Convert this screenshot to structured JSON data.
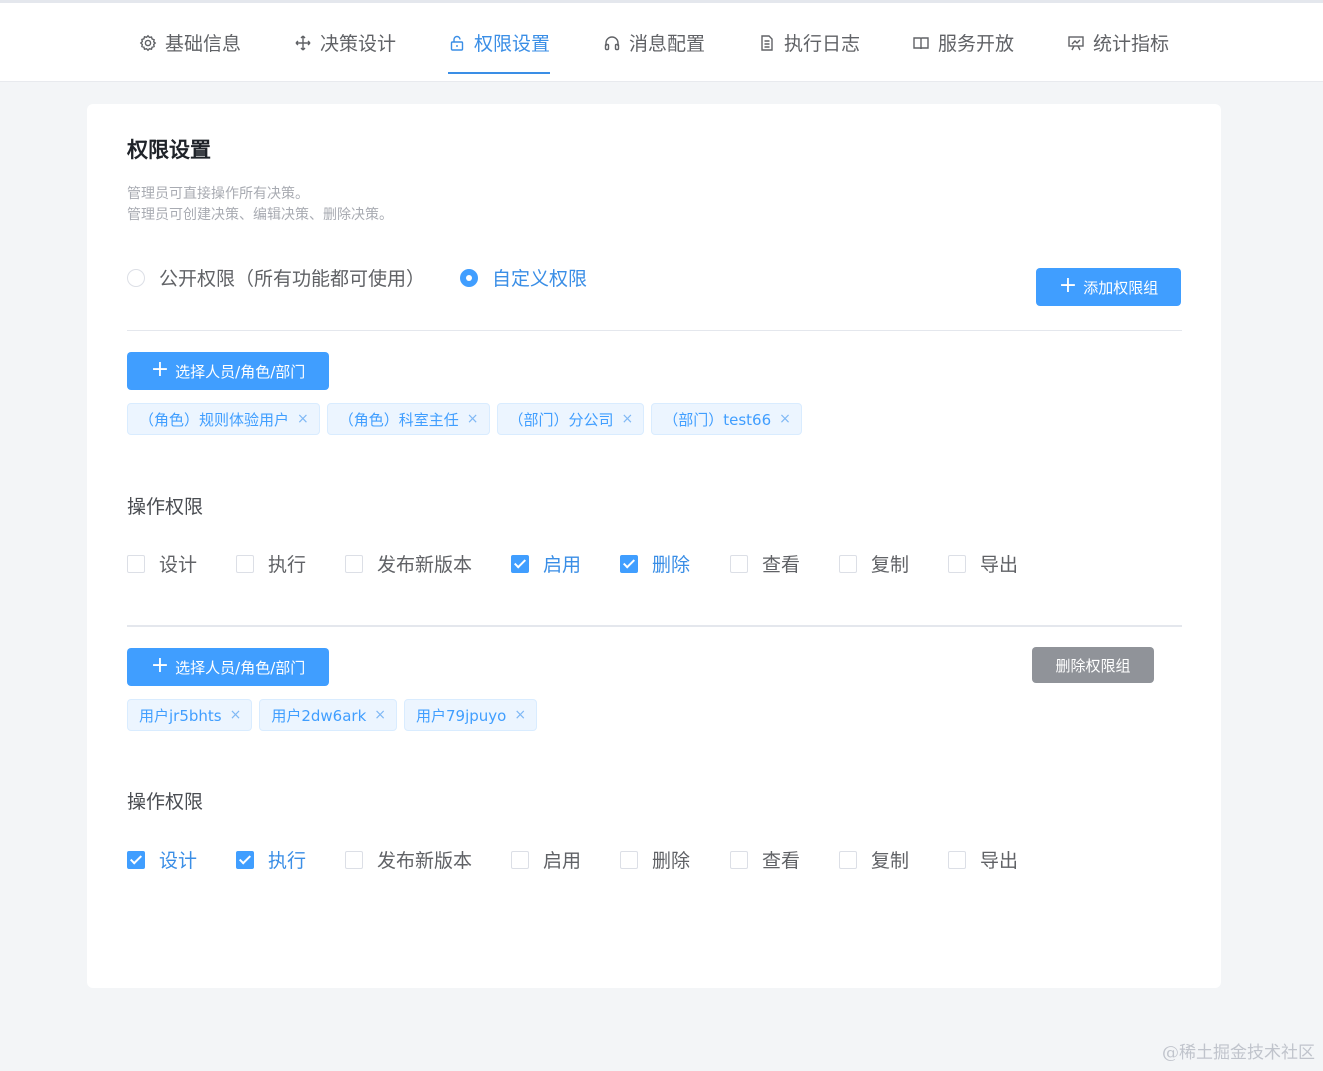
{
  "tabs": [
    {
      "label": "基础信息",
      "icon": "gear-icon"
    },
    {
      "label": "决策设计",
      "icon": "move-icon"
    },
    {
      "label": "权限设置",
      "icon": "lock-icon",
      "active": true
    },
    {
      "label": "消息配置",
      "icon": "headset-icon"
    },
    {
      "label": "执行日志",
      "icon": "document-icon"
    },
    {
      "label": "服务开放",
      "icon": "book-icon"
    },
    {
      "label": "统计指标",
      "icon": "chart-board-icon"
    }
  ],
  "page": {
    "title": "权限设置",
    "desc_line1": "管理员可直接操作所有决策。",
    "desc_line2": "管理员可创建决策、编辑决策、删除决策。",
    "radio_public": "公开权限（所有功能都可使用）",
    "radio_custom": "自定义权限",
    "selected_mode": "custom",
    "add_group_button": "添加权限组"
  },
  "groups": [
    {
      "select_button": "选择人员/角色/部门",
      "tags": [
        "（角色）规则体验用户",
        "（角色）科室主任",
        "（部门）分公司",
        "（部门）test66"
      ],
      "perm_label": "操作权限",
      "permissions": [
        {
          "label": "设计",
          "checked": false
        },
        {
          "label": "执行",
          "checked": false
        },
        {
          "label": "发布新版本",
          "checked": false
        },
        {
          "label": "启用",
          "checked": true
        },
        {
          "label": "删除",
          "checked": true
        },
        {
          "label": "查看",
          "checked": false
        },
        {
          "label": "复制",
          "checked": false
        },
        {
          "label": "导出",
          "checked": false
        }
      ]
    },
    {
      "select_button": "选择人员/角色/部门",
      "delete_button": "删除权限组",
      "tags": [
        "用户jr5bhts",
        "用户2dw6ark",
        "用户79jpuyo"
      ],
      "perm_label": "操作权限",
      "permissions": [
        {
          "label": "设计",
          "checked": true
        },
        {
          "label": "执行",
          "checked": true
        },
        {
          "label": "发布新版本",
          "checked": false
        },
        {
          "label": "启用",
          "checked": false
        },
        {
          "label": "删除",
          "checked": false
        },
        {
          "label": "查看",
          "checked": false
        },
        {
          "label": "复制",
          "checked": false
        },
        {
          "label": "导出",
          "checked": false
        }
      ]
    }
  ],
  "tag_close": "×",
  "watermark": "@稀土掘金技术社区",
  "colors": {
    "accent": "#409eff",
    "active_text": "#3a8ee6",
    "gray_button": "#909399",
    "background": "#f3f5f7"
  }
}
